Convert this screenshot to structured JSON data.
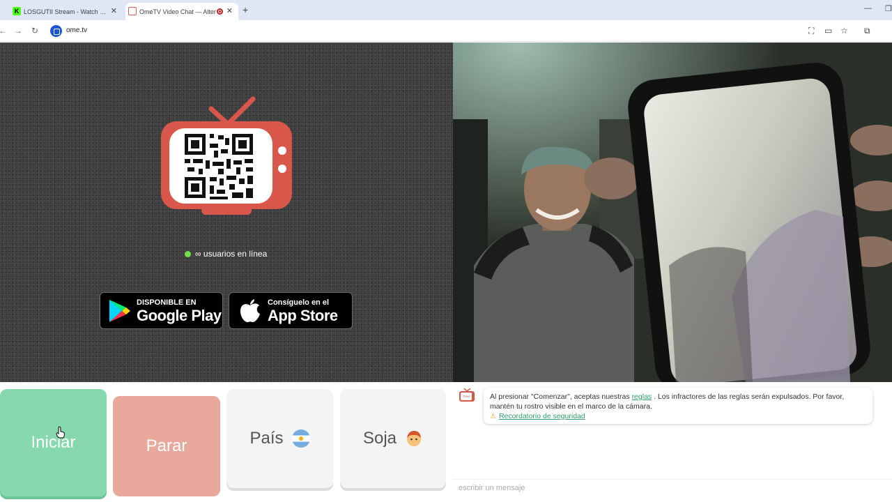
{
  "browser": {
    "tabs": [
      {
        "title": "LOSGUTII Stream - Watch Live",
        "favicon": "K",
        "active": false
      },
      {
        "title": "OmeTV Video Chat — Alter",
        "active": true
      }
    ],
    "url": "ome.tv"
  },
  "main": {
    "online_text": "∞ usuarios en línea",
    "google_play": {
      "small": "DISPONIBLE EN",
      "big": "Google Play"
    },
    "app_store": {
      "small": "Consíguelo en el",
      "big": "App Store"
    }
  },
  "controls": {
    "start_label": "Iniciar",
    "stop_label": "Parar",
    "country_label": "País",
    "gender_label": "Soja"
  },
  "chat": {
    "message_prefix": "Al presionar \"Comenzar\", aceptas nuestras ",
    "rules_link": "reglas",
    "message_suffix": " . Los infractores de las reglas serán expulsados. Por favor, mantén tu rostro visible en el marco de la cámara.",
    "safety_link": "Recordatorio de seguridad",
    "input_placeholder": "escribir un mensaje"
  },
  "colors": {
    "start": "#86d8ad",
    "stop": "#e8a99c",
    "brand": "#d8574a",
    "online_dot": "#6ee04a"
  }
}
